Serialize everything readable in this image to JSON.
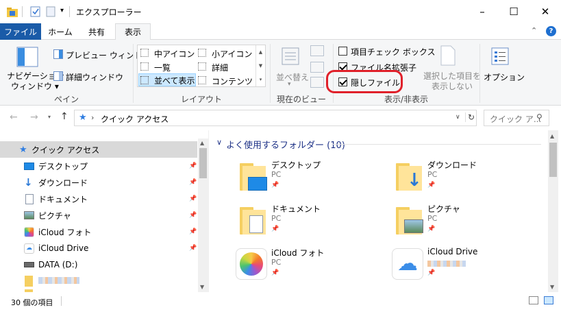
{
  "window": {
    "title": "エクスプローラー",
    "minimize": "–",
    "maximize": "☐",
    "close": "✕"
  },
  "tabs": [
    {
      "label": "ファイル"
    },
    {
      "label": "ホーム"
    },
    {
      "label": "共有"
    },
    {
      "label": "表示"
    }
  ],
  "ribbon": {
    "pane": {
      "nav_pane_line1": "ナビゲーション",
      "nav_pane_line2": "ウィンドウ",
      "preview": "プレビュー ウィンドウ",
      "details": "詳細ウィンドウ",
      "group": "ペイン"
    },
    "layout": {
      "items": [
        "中アイコン",
        "小アイコン",
        "一覧",
        "詳細",
        "並べて表示",
        "コンテンツ"
      ],
      "group": "レイアウト"
    },
    "current_view": {
      "sort": "並べ替え",
      "group": "現在のビュー"
    },
    "show_hide": {
      "item_checkboxes": "項目チェック ボックス",
      "file_extensions": "ファイル名拡張子",
      "hidden_files": "隠しファイル",
      "hide_selected_line1": "選択した項目を",
      "hide_selected_line2": "表示しない",
      "group": "表示/非表示"
    },
    "options": "オプション"
  },
  "nav": {
    "breadcrumb": "クイック アクセス",
    "search_placeholder": "クイック ア..."
  },
  "sidebar": {
    "items": [
      {
        "label": "クイック アクセス"
      },
      {
        "label": "デスクトップ"
      },
      {
        "label": "ダウンロード"
      },
      {
        "label": "ドキュメント"
      },
      {
        "label": "ピクチャ"
      },
      {
        "label": "iCloud フォト"
      },
      {
        "label": "iCloud Drive"
      },
      {
        "label": "DATA (D:)"
      }
    ]
  },
  "content": {
    "section_header": "よく使用するフォルダー (10)",
    "tiles": [
      {
        "name": "デスクトップ",
        "sub": "PC"
      },
      {
        "name": "ダウンロード",
        "sub": "PC"
      },
      {
        "name": "ドキュメント",
        "sub": "PC"
      },
      {
        "name": "ピクチャ",
        "sub": "PC"
      },
      {
        "name": "iCloud フォト",
        "sub": "PC"
      },
      {
        "name": "iCloud Drive",
        "sub": ""
      }
    ]
  },
  "status": {
    "count": "30 個の項目"
  },
  "colors": {
    "file_tab": "#1a5ba8",
    "highlight_circle": "#e0202a",
    "selection": "#cce8ff",
    "sidebar_selected": "#d9d9d9"
  }
}
